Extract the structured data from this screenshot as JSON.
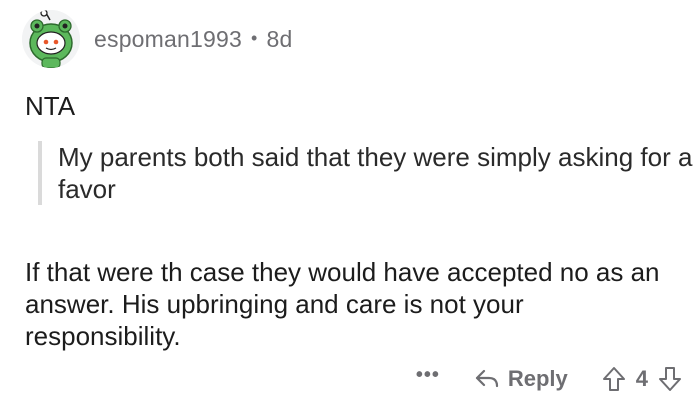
{
  "comment": {
    "username": "espoman1993",
    "separator": "•",
    "age": "8d",
    "avatar_icon": "snoo-frog-avatar-icon",
    "lines": {
      "verdict": "NTA",
      "quote": "My parents both said that they were simply asking for a favor",
      "body": "If that were th case they would have accepted no as an answer. His upbringing and care is not your responsibility."
    }
  },
  "actions": {
    "more": "•••",
    "reply_label": "Reply",
    "score": "4",
    "upvote_icon": "upvote-arrow-icon",
    "downvote_icon": "downvote-arrow-icon",
    "reply_icon": "reply-arrow-icon"
  },
  "colors": {
    "text": "#1c1c1c",
    "muted": "#6e6e72",
    "quote_bar": "#dadada",
    "avatar_green": "#5cb85c"
  }
}
